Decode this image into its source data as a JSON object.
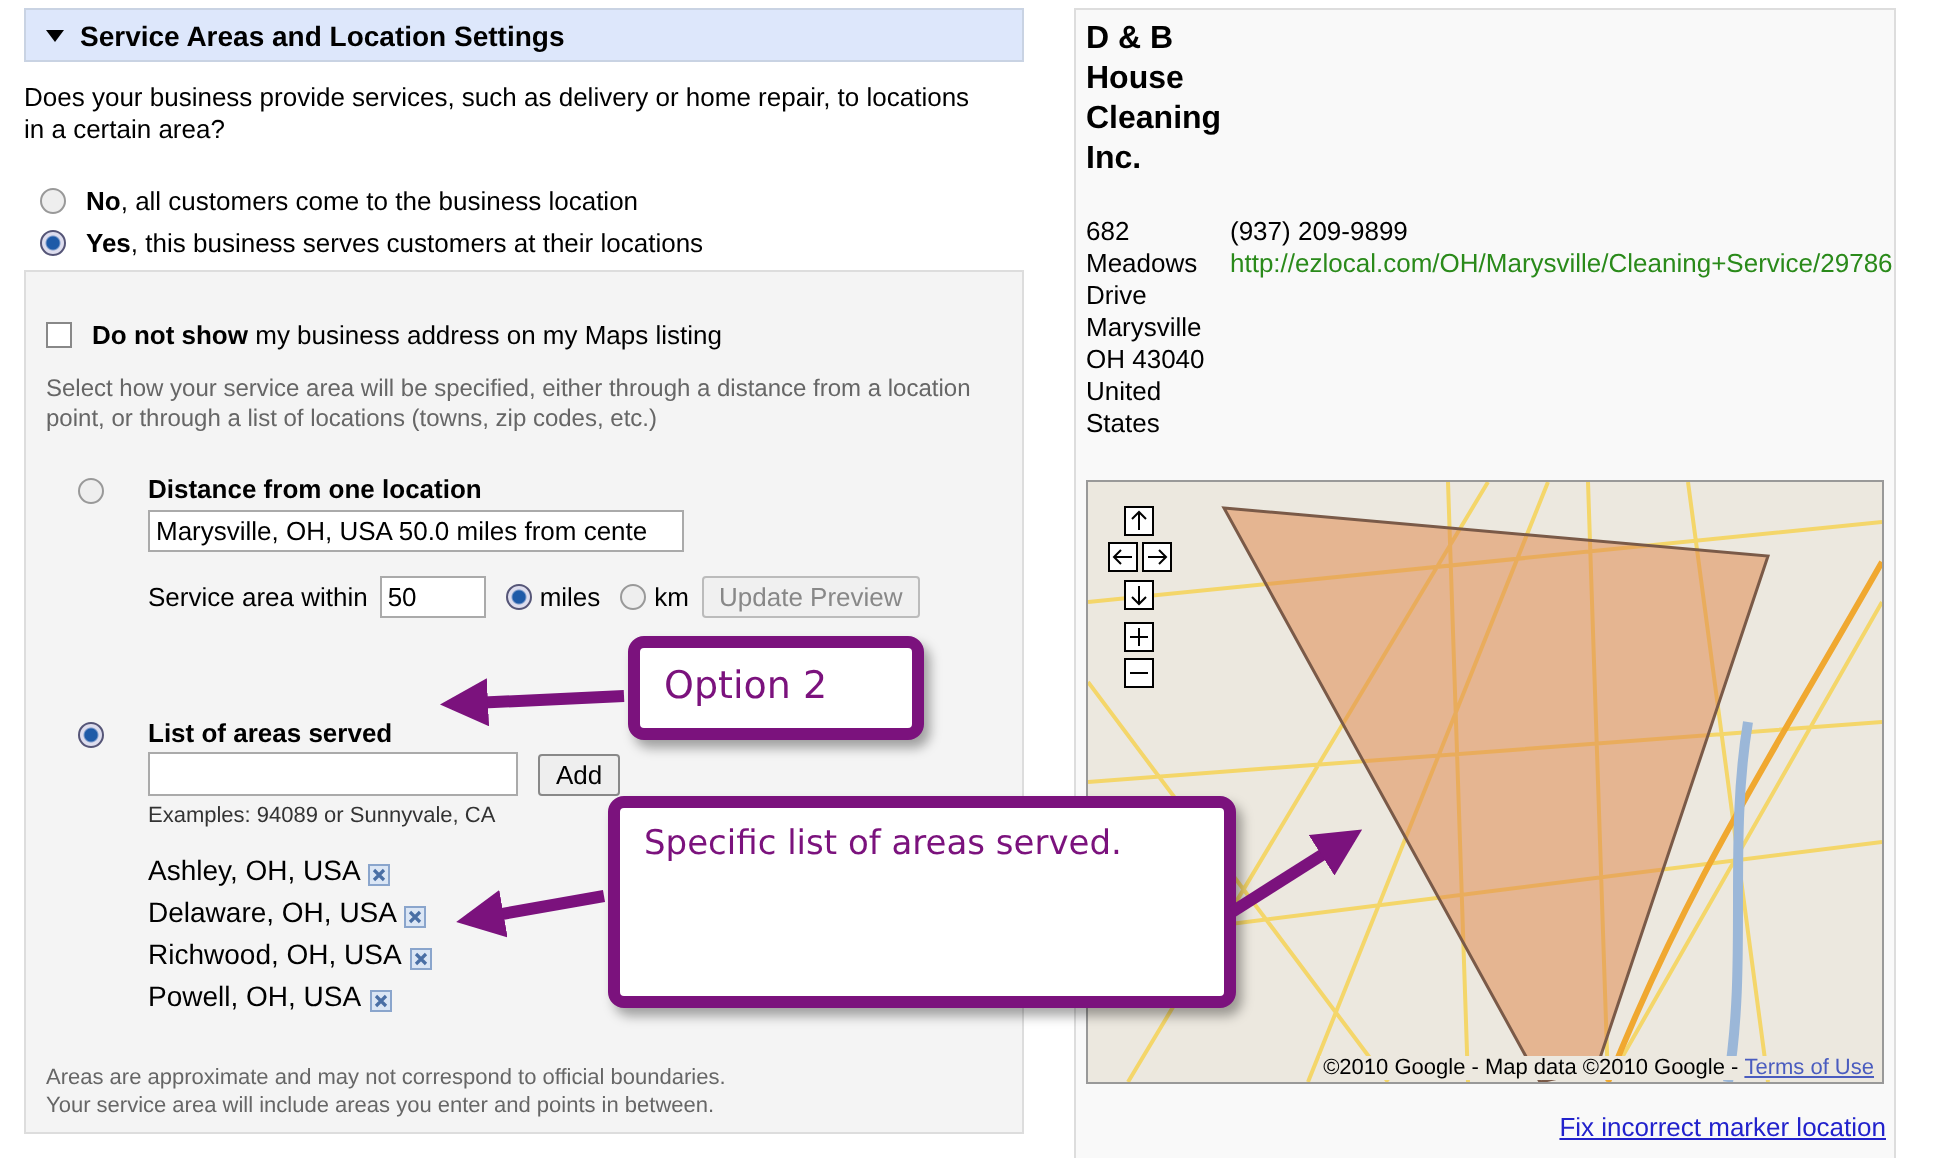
{
  "section": {
    "title": "Service Areas and Location Settings",
    "expanded": true
  },
  "question": "Does your business provide services, such as delivery or home repair, to locations in a certain area?",
  "service_options": [
    {
      "label": "**No**, all customers come to the business location",
      "selected": false
    },
    {
      "label": "**Yes**, this business serves customers at their locations",
      "selected": true
    }
  ],
  "hide_address": {
    "label": "**Do not show** my business address on my Maps listing",
    "checked": false
  },
  "instructions": "Select how your service area will be specified, either through a distance from a location point, or through a list of locations (towns, zip codes, etc.)",
  "distance_option": {
    "label": "Distance from one location",
    "selected": false,
    "location_value": "Marysville, OH, USA 50.0 miles from cente",
    "within_label": "Service area within",
    "radius_value": "50",
    "units": [
      {
        "label": "miles",
        "selected": true
      },
      {
        "label": "km",
        "selected": false
      }
    ],
    "update_button": "Update Preview"
  },
  "list_option": {
    "label": "List of areas served",
    "selected": true,
    "add_button": "Add",
    "examples": "Examples: 94089 or Sunnyvale, CA",
    "areas": [
      "Ashley, OH, USA",
      "Delaware, OH, USA",
      "Richwood, OH, USA",
      "Powell, OH, USA"
    ]
  },
  "disclaimer": [
    "Areas are approximate and may not correspond to official boundaries.",
    "Your service area will include areas you enter and points in between."
  ],
  "business": {
    "name": "D & B House Cleaning Inc.",
    "address": "682 Meadows Drive Marysville OH 43040 United States",
    "phone": "(937) 209-9899",
    "website": "http://ezlocal.com/OH/Marysville/Cleaning+Service/29786"
  },
  "map": {
    "attribution": "©2010 Google - Map data ©2010 Google -",
    "terms_link": "Terms of Use"
  },
  "fix_link": "Fix incorrect marker location",
  "callouts": [
    {
      "text": "Option 2"
    },
    {
      "text": "Specific list of areas served."
    }
  ]
}
